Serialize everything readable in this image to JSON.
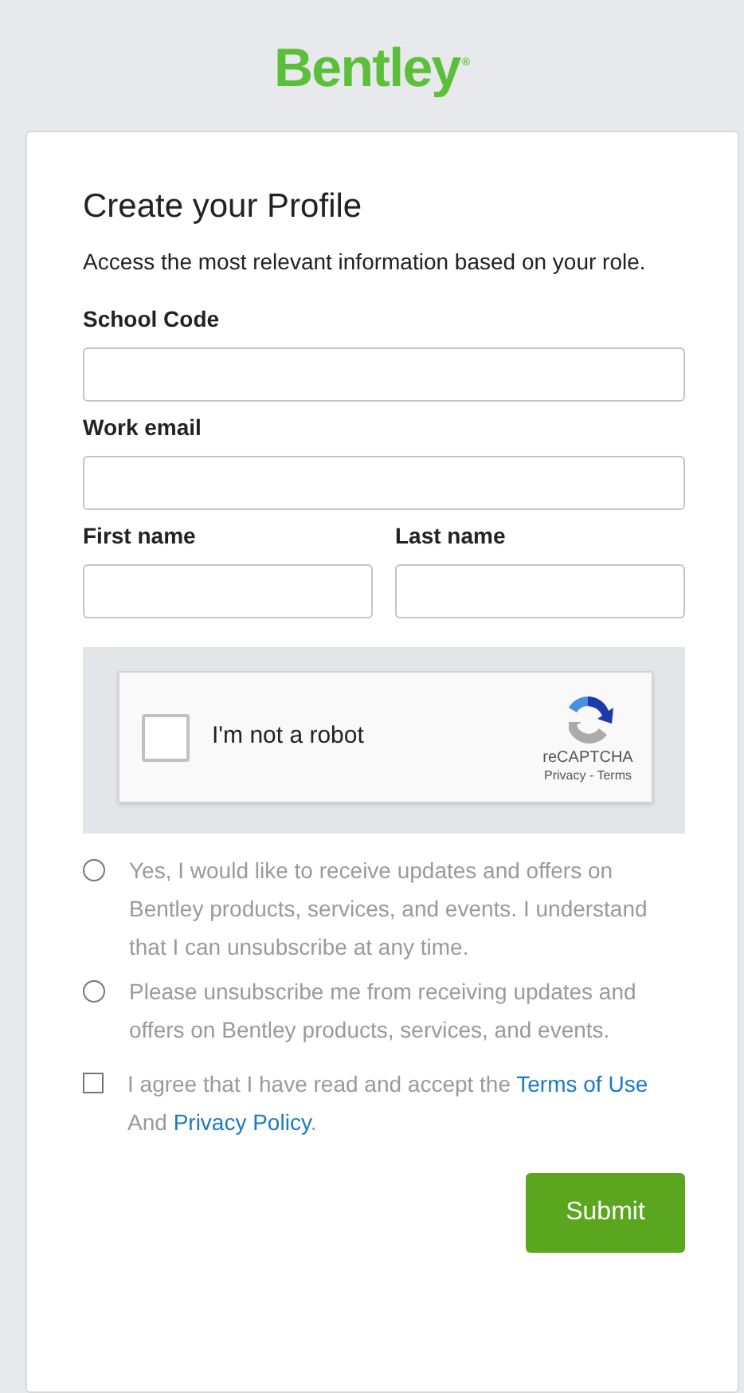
{
  "logo": {
    "text": "Bentley",
    "mark": "®"
  },
  "title": "Create your Profile",
  "intro": "Access the most relevant information based on your role.",
  "fields": [
    {
      "label": "School Code",
      "half": false
    },
    {
      "label": "Work email",
      "half": false
    },
    {
      "label": "First name",
      "half": true
    },
    {
      "label": "Last name",
      "half": true
    }
  ],
  "captcha": {
    "label": "I'm not a robot",
    "checked": false,
    "brand": "reCAPTCHA",
    "privacy": "Privacy",
    "separator": " - ",
    "terms": "Terms"
  },
  "options": [
    {
      "kind": "radio",
      "selected": false,
      "text": "Yes, I would like to receive updates and offers on Bentley products, services, and events. I understand that I can unsubscribe at any time."
    },
    {
      "kind": "radio",
      "selected": false,
      "text": "Please unsubscribe me from receiving updates and offers on Bentley products, services, and events."
    }
  ],
  "agreement": {
    "checked": false,
    "text": "I agree that I have read and accept the",
    "link1": "Terms of Use",
    "middle": "And",
    "link2": "Privacy Policy",
    "end": "."
  },
  "submit": "Submit"
}
